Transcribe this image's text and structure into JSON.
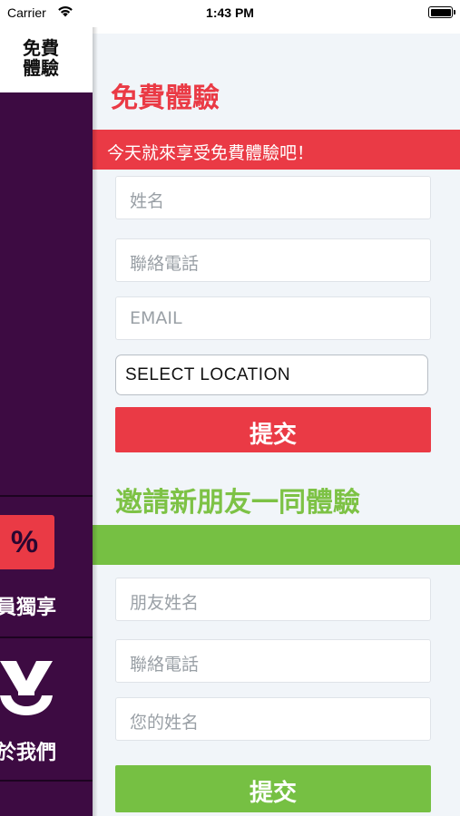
{
  "status_bar": {
    "carrier": "Carrier",
    "time": "1:43 PM"
  },
  "sidebar": {
    "title_line1": "免費",
    "title_line2": "體驗",
    "promo_symbol": "%",
    "member_label": "員獨享",
    "about_label": "於我們"
  },
  "trial": {
    "title": "免費體驗",
    "banner": "今天就來享受免費體驗吧！",
    "name_placeholder": "姓名",
    "phone_placeholder": "聯絡電話",
    "email_placeholder": "EMAIL",
    "location_value": "SELECT LOCATION",
    "submit_label": "提交"
  },
  "invite": {
    "title": "邀請新朋友一同體驗",
    "banner": "",
    "friend_name_placeholder": "朋友姓名",
    "phone_placeholder": "聯絡電話",
    "your_name_placeholder": "您的姓名",
    "submit_label": "提交"
  },
  "colors": {
    "sidebar_bg": "#3d0b42",
    "accent_red": "#ea3a45",
    "accent_green": "#76c043",
    "panel_bg": "#f1f5f9"
  },
  "icons": {
    "wifi": "wifi-icon",
    "battery": "battery-icon",
    "promo": "percent-icon",
    "about": "about-logo-icon"
  }
}
